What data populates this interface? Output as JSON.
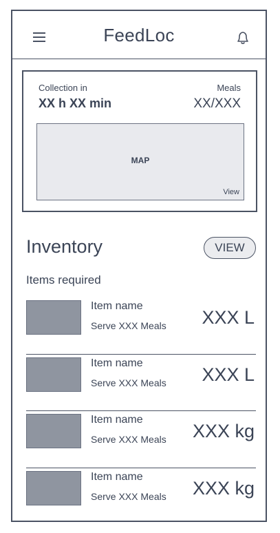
{
  "app": {
    "title": "FeedLoc"
  },
  "collection": {
    "label": "Collection in",
    "time": "XX h XX min",
    "meals_label": "Meals",
    "meals_value": "XX/XXX",
    "map_label": "MAP",
    "map_view_label": "View"
  },
  "inventory": {
    "title": "Inventory",
    "view_button": "VIEW",
    "items_required_label": "Items required",
    "items": [
      {
        "name": "Item name",
        "serve": "Serve XXX Meals",
        "qty": "XXX L"
      },
      {
        "name": "Item name",
        "serve": "Serve XXX Meals",
        "qty": "XXX L"
      },
      {
        "name": "Item name",
        "serve": "Serve XXX Meals",
        "qty": "XXX kg"
      },
      {
        "name": "Item name",
        "serve": "Serve XXX Meals",
        "qty": "XXX kg"
      }
    ]
  },
  "icons": {
    "menu": "hamburger-menu-icon",
    "notifications": "bell-icon"
  },
  "colors": {
    "ink": "#3b4456",
    "border": "#4a5263",
    "map_fill": "#e9eaee",
    "thumb_fill": "#8f95a0"
  }
}
